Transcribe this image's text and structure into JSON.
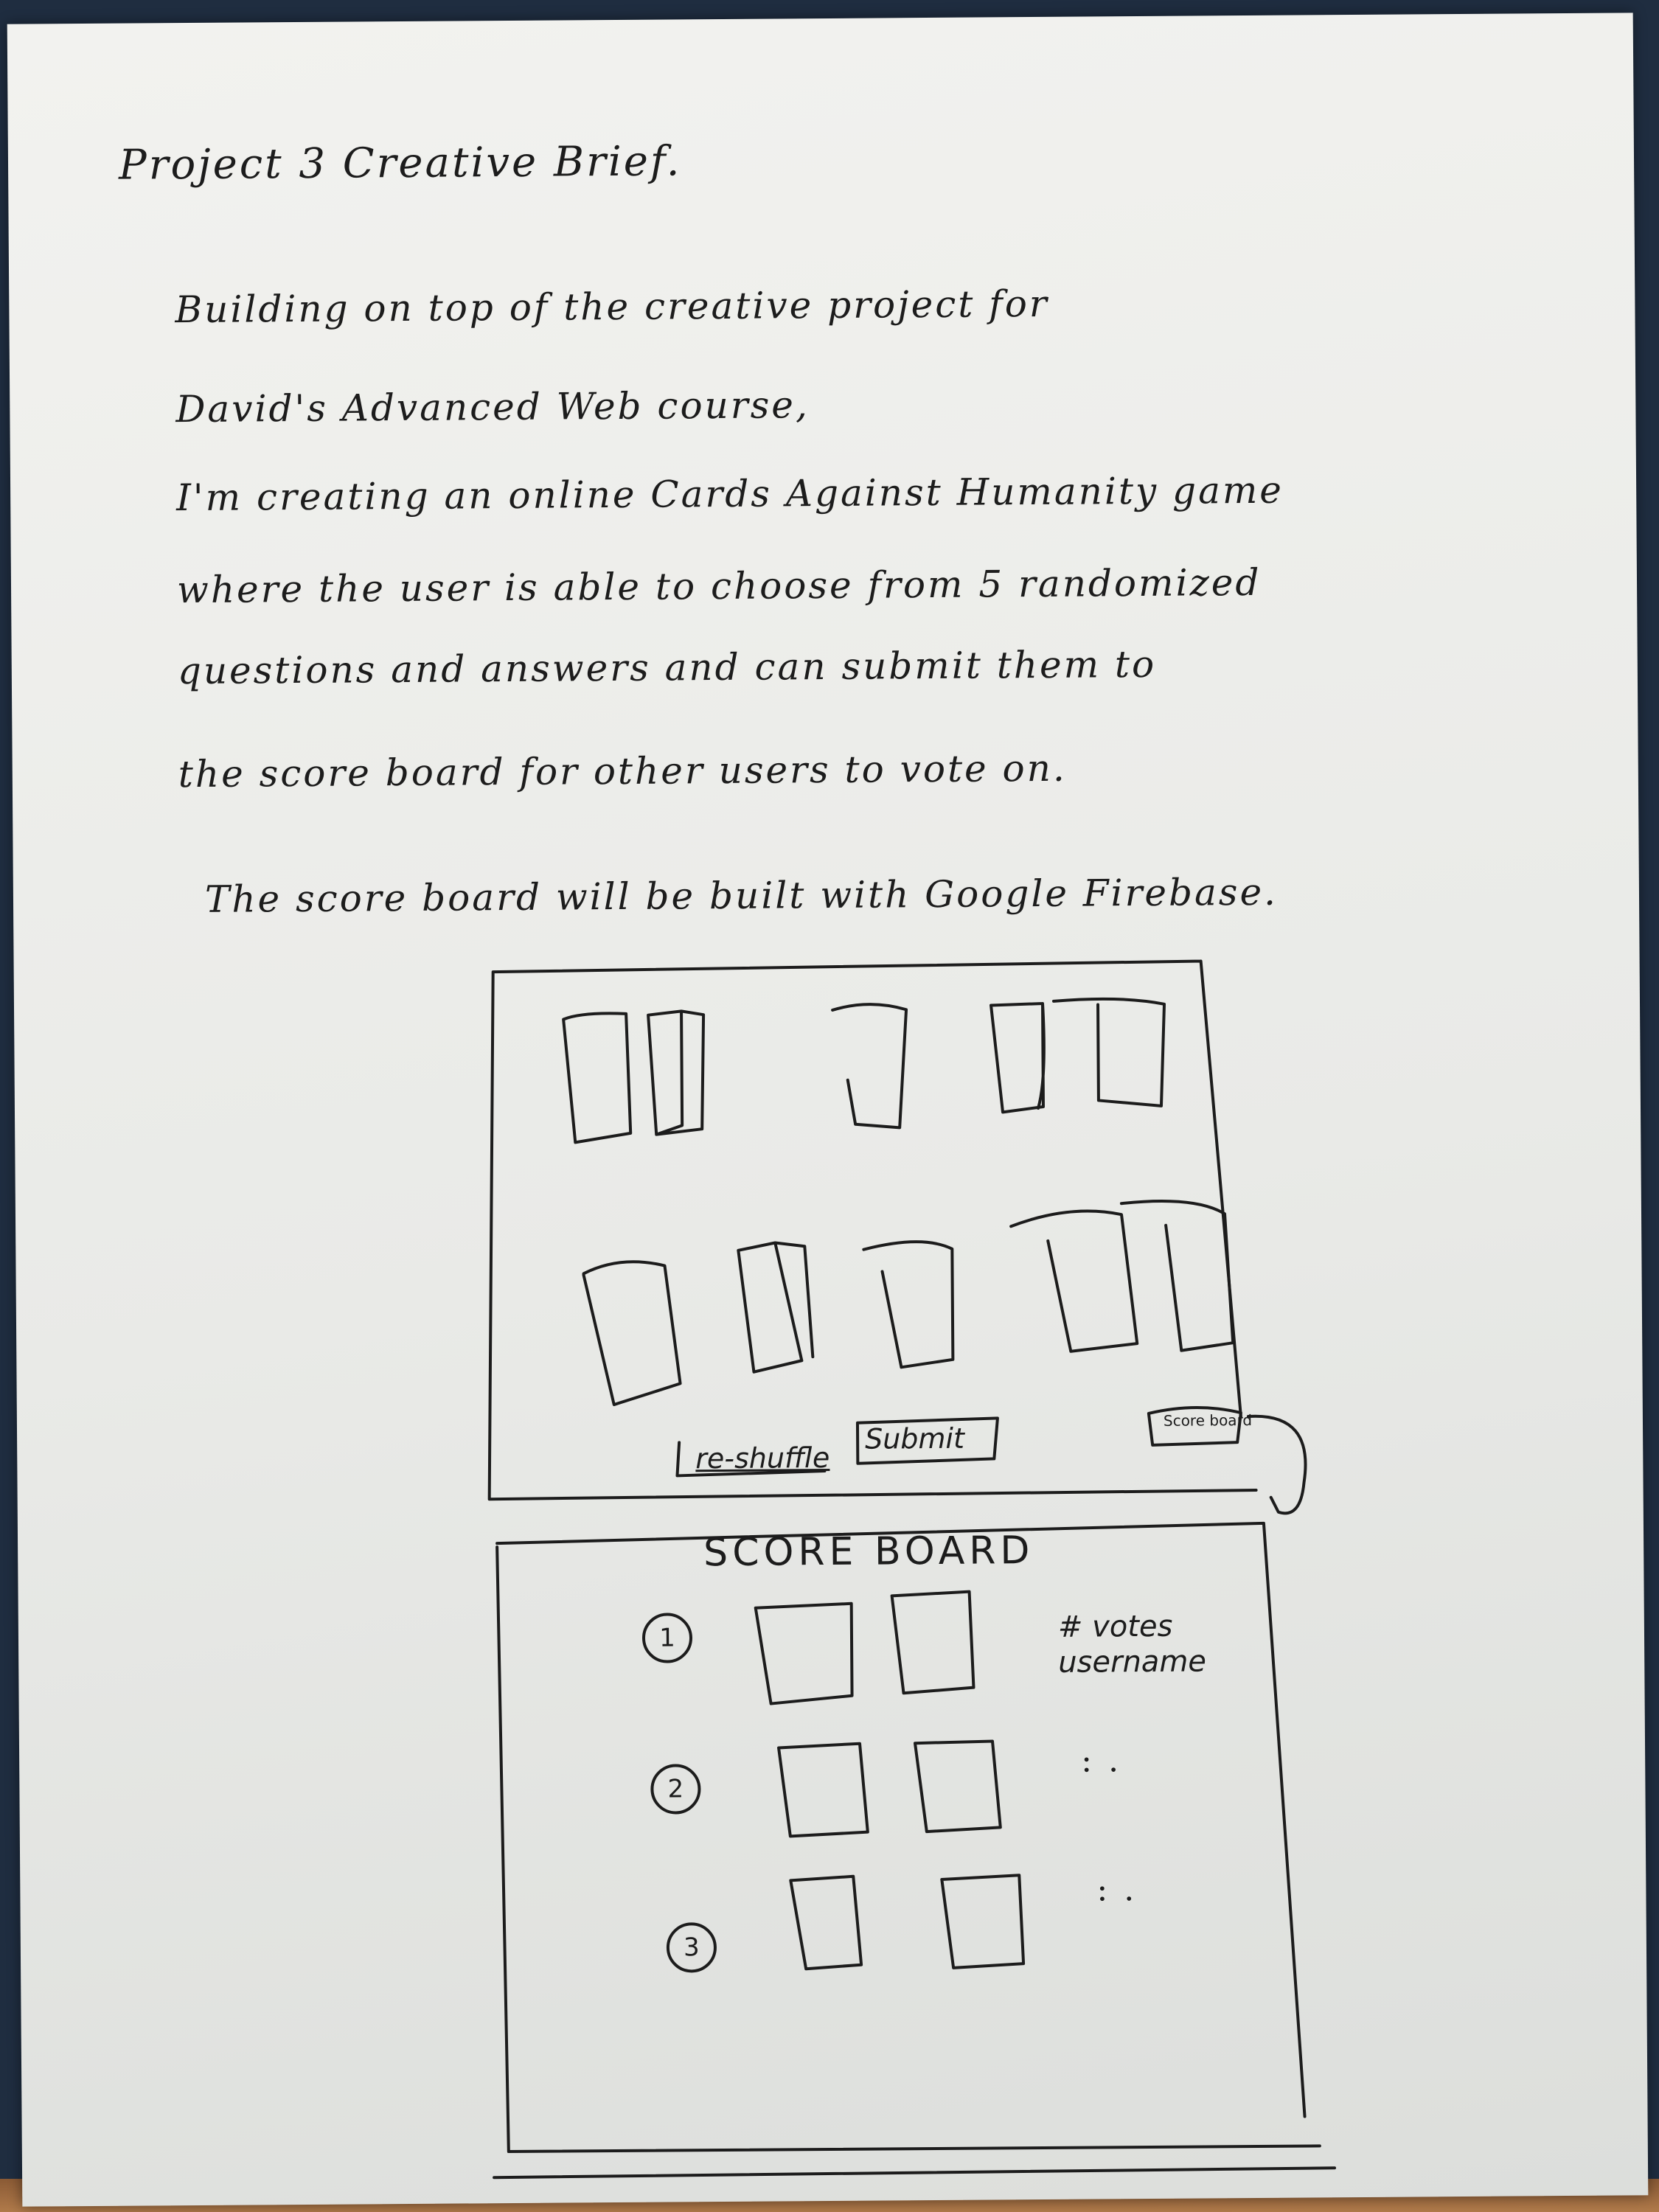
{
  "document": {
    "title": "Project 3 Creative Brief.",
    "lines": [
      "Building on top of the creative project for",
      "David's Advanced Web course,",
      "I'm creating an online Cards Against Humanity game",
      "where the user is able to choose from 5 randomized",
      "questions and answers and can submit them to",
      "the score board for other users to vote on.",
      "The score board will be built with Google Firebase."
    ]
  },
  "sketch": {
    "buttons": {
      "reshuffle": "re-shuffle",
      "submit": "Submit",
      "scoreboard": "Score board"
    },
    "scoreboard": {
      "title": "SCORE BOARD",
      "ranks": [
        "1",
        "2",
        "3"
      ],
      "info_votes": "# votes",
      "info_username": "username",
      "ellipsis": ": ."
    }
  }
}
